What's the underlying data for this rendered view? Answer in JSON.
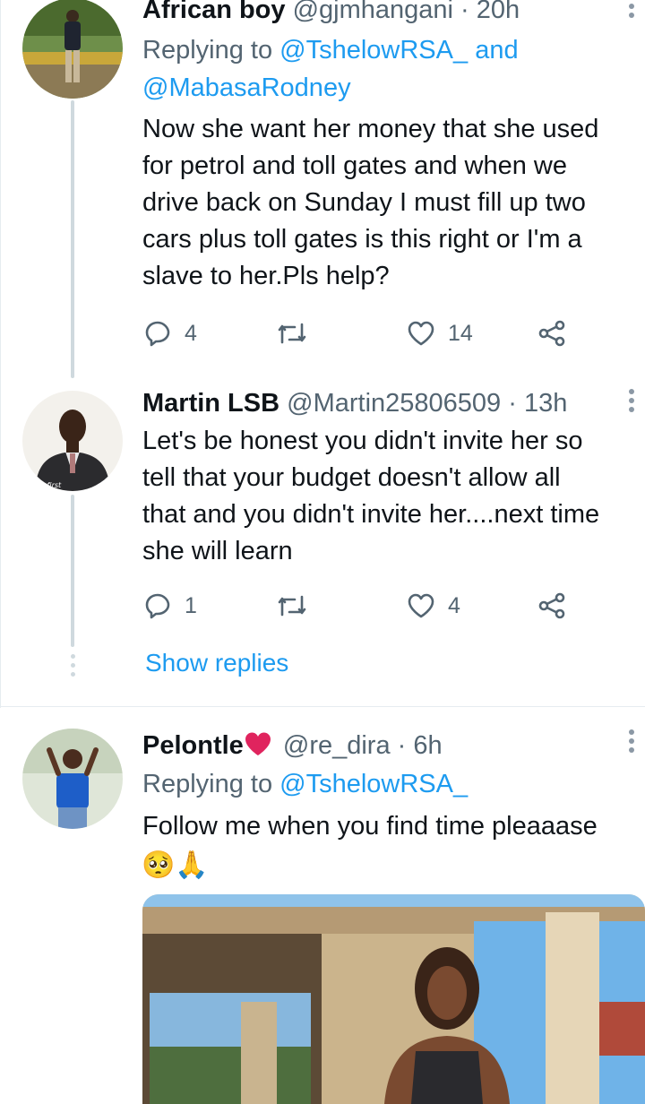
{
  "tweets": [
    {
      "name": "African boy",
      "handle": "@gjmhangani",
      "time": "20h",
      "replying_prefix": "Replying to",
      "replying_to_1": "@TshelowRSA_",
      "replying_and": "and",
      "replying_to_2": "@MabasaRodney",
      "text_lines": [
        "Now she want her money that she used",
        "for petrol and toll gates and when we",
        "drive back on Sunday I  must fill up two",
        "cars plus toll gates is this right or I'm a",
        "slave to her.Pls help?"
      ],
      "replies": "4",
      "likes": "14"
    },
    {
      "name": "Martin LSB",
      "handle": "@Martin25806509",
      "time": "13h",
      "text_lines": [
        "Let's be honest you didn't invite her so",
        "tell that your budget doesn't allow all",
        "that and you didn't invite her....next time",
        "she will learn"
      ],
      "replies": "1",
      "likes": "4",
      "avatar_caption": "The first"
    },
    {
      "name": "Pelontle",
      "handle": "@re_dira",
      "time": "6h",
      "replying_prefix": "Replying to",
      "replying_to_1": "@TshelowRSA_",
      "text_lines": [
        "Follow me when you find time pleaaase"
      ],
      "emoji": "🥺🙏"
    }
  ],
  "show_replies": "Show replies",
  "separator": "·",
  "icons": {
    "reply": "reply-icon",
    "retweet": "retweet-icon",
    "like": "heart-icon",
    "share": "share-icon",
    "more": "more-icon",
    "name_badge": "red-heart-icon"
  },
  "colors": {
    "link": "#1d9bf0",
    "text": "#0f1419",
    "muted": "#536471",
    "heart": "#e0245e"
  }
}
